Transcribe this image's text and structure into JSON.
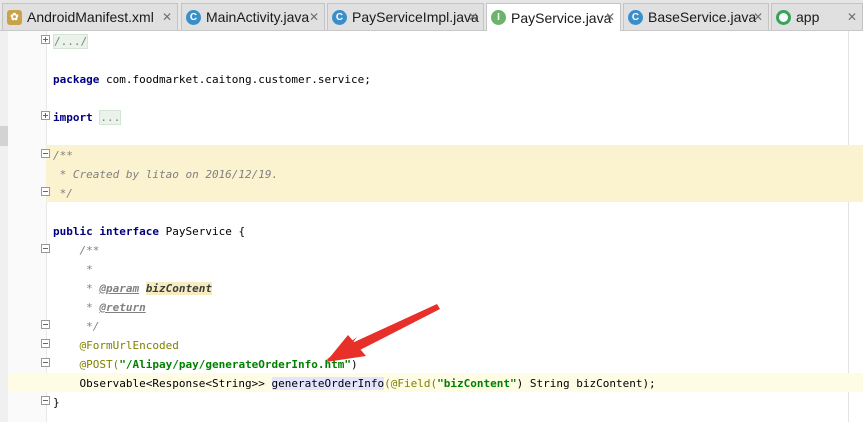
{
  "tabs": [
    {
      "label": "AndroidManifest.xml",
      "icon": "xml-manifest-icon",
      "active": false
    },
    {
      "label": "MainActivity.java",
      "icon": "class-c-icon",
      "active": false
    },
    {
      "label": "PayServiceImpl.java",
      "icon": "class-c-icon",
      "active": false
    },
    {
      "label": "PayService.java",
      "icon": "interface-i-icon",
      "active": true
    },
    {
      "label": "BaseService.java",
      "icon": "class-c-icon",
      "active": false
    },
    {
      "label": "app",
      "icon": "module-icon",
      "active": false
    }
  ],
  "tab_close": "✕",
  "code": {
    "l1_fold": "/.../",
    "l2_kw": "package",
    "l2_rest": " com.foodmarket.caitong.customer.service;",
    "l3_kw": "import",
    "l3_fold": "...",
    "l4": "/**",
    "l5": " * Created by litao on 2016/12/19.",
    "l6": " */",
    "l7_kw1": "public",
    "l7_kw2": "interface",
    "l7_rest": " PayService {",
    "l8": "    /**",
    "l9": "     *",
    "l10_pre": "     * ",
    "l10_tag": "@param",
    "l10_name": "bizContent",
    "l11_pre": "     * ",
    "l11_tag": "@return",
    "l12": "     */",
    "l13": "    @FormUrlEncoded",
    "l14_ann": "    @POST(",
    "l14_str": "\"/Alipay/pay/generateOrderInfo.htm\"",
    "l14_end": ")",
    "l15_pre": "    Observable<Response<String>> ",
    "l15_method": "generateOrderInfo",
    "l15_ann": "(@Field(",
    "l15_str": "\"bizContent\"",
    "l15_end": ") String bizContent);",
    "l16": "}"
  },
  "colors": {
    "keyword": "#000080",
    "comment": "#808080",
    "annotation": "#808000",
    "string": "#008000",
    "arrow": "#e8302a",
    "comment_band": "#fbf3cf"
  }
}
